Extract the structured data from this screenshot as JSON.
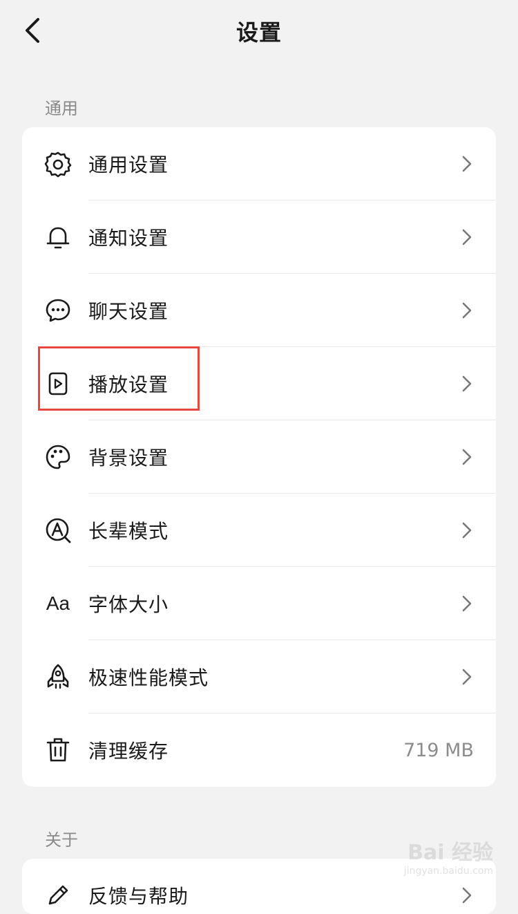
{
  "header": {
    "title": "设置"
  },
  "sections": [
    {
      "label": "通用",
      "items": [
        {
          "label": "通用设置",
          "icon": "gear-icon",
          "value": ""
        },
        {
          "label": "通知设置",
          "icon": "bell-icon",
          "value": ""
        },
        {
          "label": "聊天设置",
          "icon": "chat-bubble-icon",
          "value": ""
        },
        {
          "label": "播放设置",
          "icon": "play-icon",
          "value": ""
        },
        {
          "label": "背景设置",
          "icon": "palette-icon",
          "value": ""
        },
        {
          "label": "长辈模式",
          "icon": "elder-mode-icon",
          "value": ""
        },
        {
          "label": "字体大小",
          "icon": "font-size-icon",
          "value": ""
        },
        {
          "label": "极速性能模式",
          "icon": "rocket-icon",
          "value": ""
        },
        {
          "label": "清理缓存",
          "icon": "trash-icon",
          "value": "719 MB"
        }
      ]
    },
    {
      "label": "关于",
      "items": [
        {
          "label": "反馈与帮助",
          "icon": "pencil-icon",
          "value": ""
        }
      ]
    }
  ],
  "font_icon_text": "Aa",
  "highlight_color": "#e8473d",
  "watermark": {
    "main": "Bai 经验",
    "sub": "jingyan.baidu.com"
  }
}
